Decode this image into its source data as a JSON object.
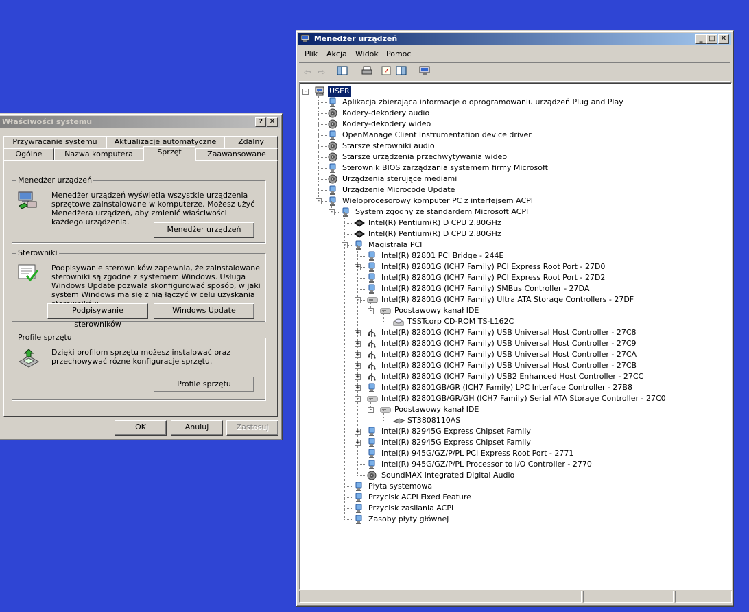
{
  "sysprops": {
    "title": "Właściwości systemu",
    "help": "?",
    "close": "✕",
    "tabs_row1": [
      "Przywracanie systemu",
      "Aktualizacje automatyczne",
      "Zdalny"
    ],
    "tabs_row2": [
      "Ogólne",
      "Nazwa komputera",
      "Sprzęt",
      "Zaawansowane"
    ],
    "group_devmgr": {
      "label": "Menedżer urządzeń",
      "text": "Menedżer urządzeń wyświetla wszystkie urządzenia sprzętowe zainstalowane w komputerze. Możesz użyć Menedżera urządzeń, aby zmienić właściwości każdego urządzenia.",
      "button": "Menedżer urządzeń"
    },
    "group_drivers": {
      "label": "Sterowniki",
      "text": "Podpisywanie sterowników zapewnia, że zainstalowane sterowniki są zgodne z systemem Windows. Usługa Windows Update pozwala skonfigurować sposób, w jaki system Windows ma się z nią łączyć w celu uzyskania sterowników.",
      "button1": "Podpisywanie sterowników",
      "button2": "Windows Update"
    },
    "group_profiles": {
      "label": "Profile sprzętu",
      "text": "Dzięki profilom sprzętu możesz instalować oraz przechowywać różne konfiguracje sprzętu.",
      "button": "Profile sprzętu"
    },
    "ok": "OK",
    "cancel": "Anuluj",
    "apply": "Zastosuj"
  },
  "devmgr": {
    "title": "Menedżer urządzeń",
    "menu": [
      "Plik",
      "Akcja",
      "Widok",
      "Pomoc"
    ],
    "tree": [
      {
        "label": "USER",
        "icon": "computer-icon",
        "level": 0,
        "exp": "-",
        "sel": true
      },
      {
        "label": "Aplikacja zbierająca informacje o oprogramowaniu urządzeń Plug and Play",
        "icon": "device-icon",
        "level": 1
      },
      {
        "label": "Kodery-dekodery audio",
        "icon": "speaker-icon",
        "level": 1
      },
      {
        "label": "Kodery-dekodery wideo",
        "icon": "speaker-icon",
        "level": 1
      },
      {
        "label": "OpenManage Client Instrumentation device driver",
        "icon": "device-icon",
        "level": 1
      },
      {
        "label": "Starsze sterowniki audio",
        "icon": "speaker-icon",
        "level": 1
      },
      {
        "label": "Starsze urządzenia przechwytywania wideo",
        "icon": "speaker-icon",
        "level": 1
      },
      {
        "label": "Sterownik BIOS zarządzania systemem firmy Microsoft",
        "icon": "device-icon",
        "level": 1
      },
      {
        "label": "Urządzenia sterujące mediami",
        "icon": "speaker-icon",
        "level": 1
      },
      {
        "label": "Urządzenie Microcode Update",
        "icon": "device-icon",
        "level": 1
      },
      {
        "label": "Wieloprocesorowy komputer PC z interfejsem ACPI",
        "icon": "device-icon",
        "level": 1,
        "exp": "-"
      },
      {
        "label": "System zgodny ze standardem Microsoft ACPI",
        "icon": "device-icon",
        "level": 2,
        "exp": "-"
      },
      {
        "label": "Intel(R) Pentium(R) D CPU 2.80GHz",
        "icon": "cpu-icon",
        "level": 3
      },
      {
        "label": "Intel(R) Pentium(R) D CPU 2.80GHz",
        "icon": "cpu-icon",
        "level": 3
      },
      {
        "label": "Magistrala PCI",
        "icon": "device-icon",
        "level": 3,
        "exp": "-"
      },
      {
        "label": "Intel(R) 82801 PCI Bridge - 244E",
        "icon": "device-icon",
        "level": 4
      },
      {
        "label": "Intel(R) 82801G (ICH7 Family) PCI Express Root Port - 27D0",
        "icon": "device-icon",
        "level": 4,
        "exp": "+"
      },
      {
        "label": "Intel(R) 82801G (ICH7 Family) PCI Express Root Port - 27D2",
        "icon": "device-icon",
        "level": 4
      },
      {
        "label": "Intel(R) 82801G (ICH7 Family) SMBus Controller - 27DA",
        "icon": "device-icon",
        "level": 4
      },
      {
        "label": "Intel(R) 82801G (ICH7 Family) Ultra ATA Storage Controllers - 27DF",
        "icon": "drive-icon",
        "level": 4,
        "exp": "-"
      },
      {
        "label": "Podstawowy kanał IDE",
        "icon": "drive-icon",
        "level": 5,
        "exp": "-"
      },
      {
        "label": "TSSTcorp CD-ROM  TS-L162C",
        "icon": "cdrom-icon",
        "level": 6
      },
      {
        "label": "Intel(R) 82801G (ICH7 Family) USB Universal Host Controller - 27C8",
        "icon": "usb-icon",
        "level": 4,
        "exp": "+"
      },
      {
        "label": "Intel(R) 82801G (ICH7 Family) USB Universal Host Controller - 27C9",
        "icon": "usb-icon",
        "level": 4,
        "exp": "+"
      },
      {
        "label": "Intel(R) 82801G (ICH7 Family) USB Universal Host Controller - 27CA",
        "icon": "usb-icon",
        "level": 4,
        "exp": "+"
      },
      {
        "label": "Intel(R) 82801G (ICH7 Family) USB Universal Host Controller - 27CB",
        "icon": "usb-icon",
        "level": 4,
        "exp": "+"
      },
      {
        "label": "Intel(R) 82801G (ICH7 Family) USB2 Enhanced Host Controller - 27CC",
        "icon": "usb-icon",
        "level": 4,
        "exp": "+"
      },
      {
        "label": "Intel(R) 82801GB/GR (ICH7 Family) LPC Interface Controller - 27B8",
        "icon": "device-icon",
        "level": 4,
        "exp": "+"
      },
      {
        "label": "Intel(R) 82801GB/GR/GH (ICH7 Family) Serial ATA Storage Controller - 27C0",
        "icon": "drive-icon",
        "level": 4,
        "exp": "-"
      },
      {
        "label": "Podstawowy kanał IDE",
        "icon": "drive-icon",
        "level": 5,
        "exp": "-"
      },
      {
        "label": "ST3808110AS",
        "icon": "hdd-icon",
        "level": 6
      },
      {
        "label": "Intel(R) 82945G Express Chipset Family",
        "icon": "device-icon",
        "level": 4,
        "exp": "+"
      },
      {
        "label": "Intel(R) 82945G Express Chipset Family",
        "icon": "device-icon",
        "level": 4,
        "exp": "+"
      },
      {
        "label": "Intel(R) 945G/GZ/P/PL PCI Express Root Port - 2771",
        "icon": "device-icon",
        "level": 4
      },
      {
        "label": "Intel(R) 945G/GZ/P/PL Processor to I/O Controller - 2770",
        "icon": "device-icon",
        "level": 4
      },
      {
        "label": "SoundMAX Integrated Digital Audio",
        "icon": "speaker-icon",
        "level": 4
      },
      {
        "label": "Płyta systemowa",
        "icon": "device-icon",
        "level": 3
      },
      {
        "label": "Przycisk ACPI Fixed Feature",
        "icon": "device-icon",
        "level": 3
      },
      {
        "label": "Przycisk zasilania ACPI",
        "icon": "device-icon",
        "level": 3
      },
      {
        "label": "Zasoby płyty głównej",
        "icon": "device-icon",
        "level": 3
      }
    ]
  }
}
